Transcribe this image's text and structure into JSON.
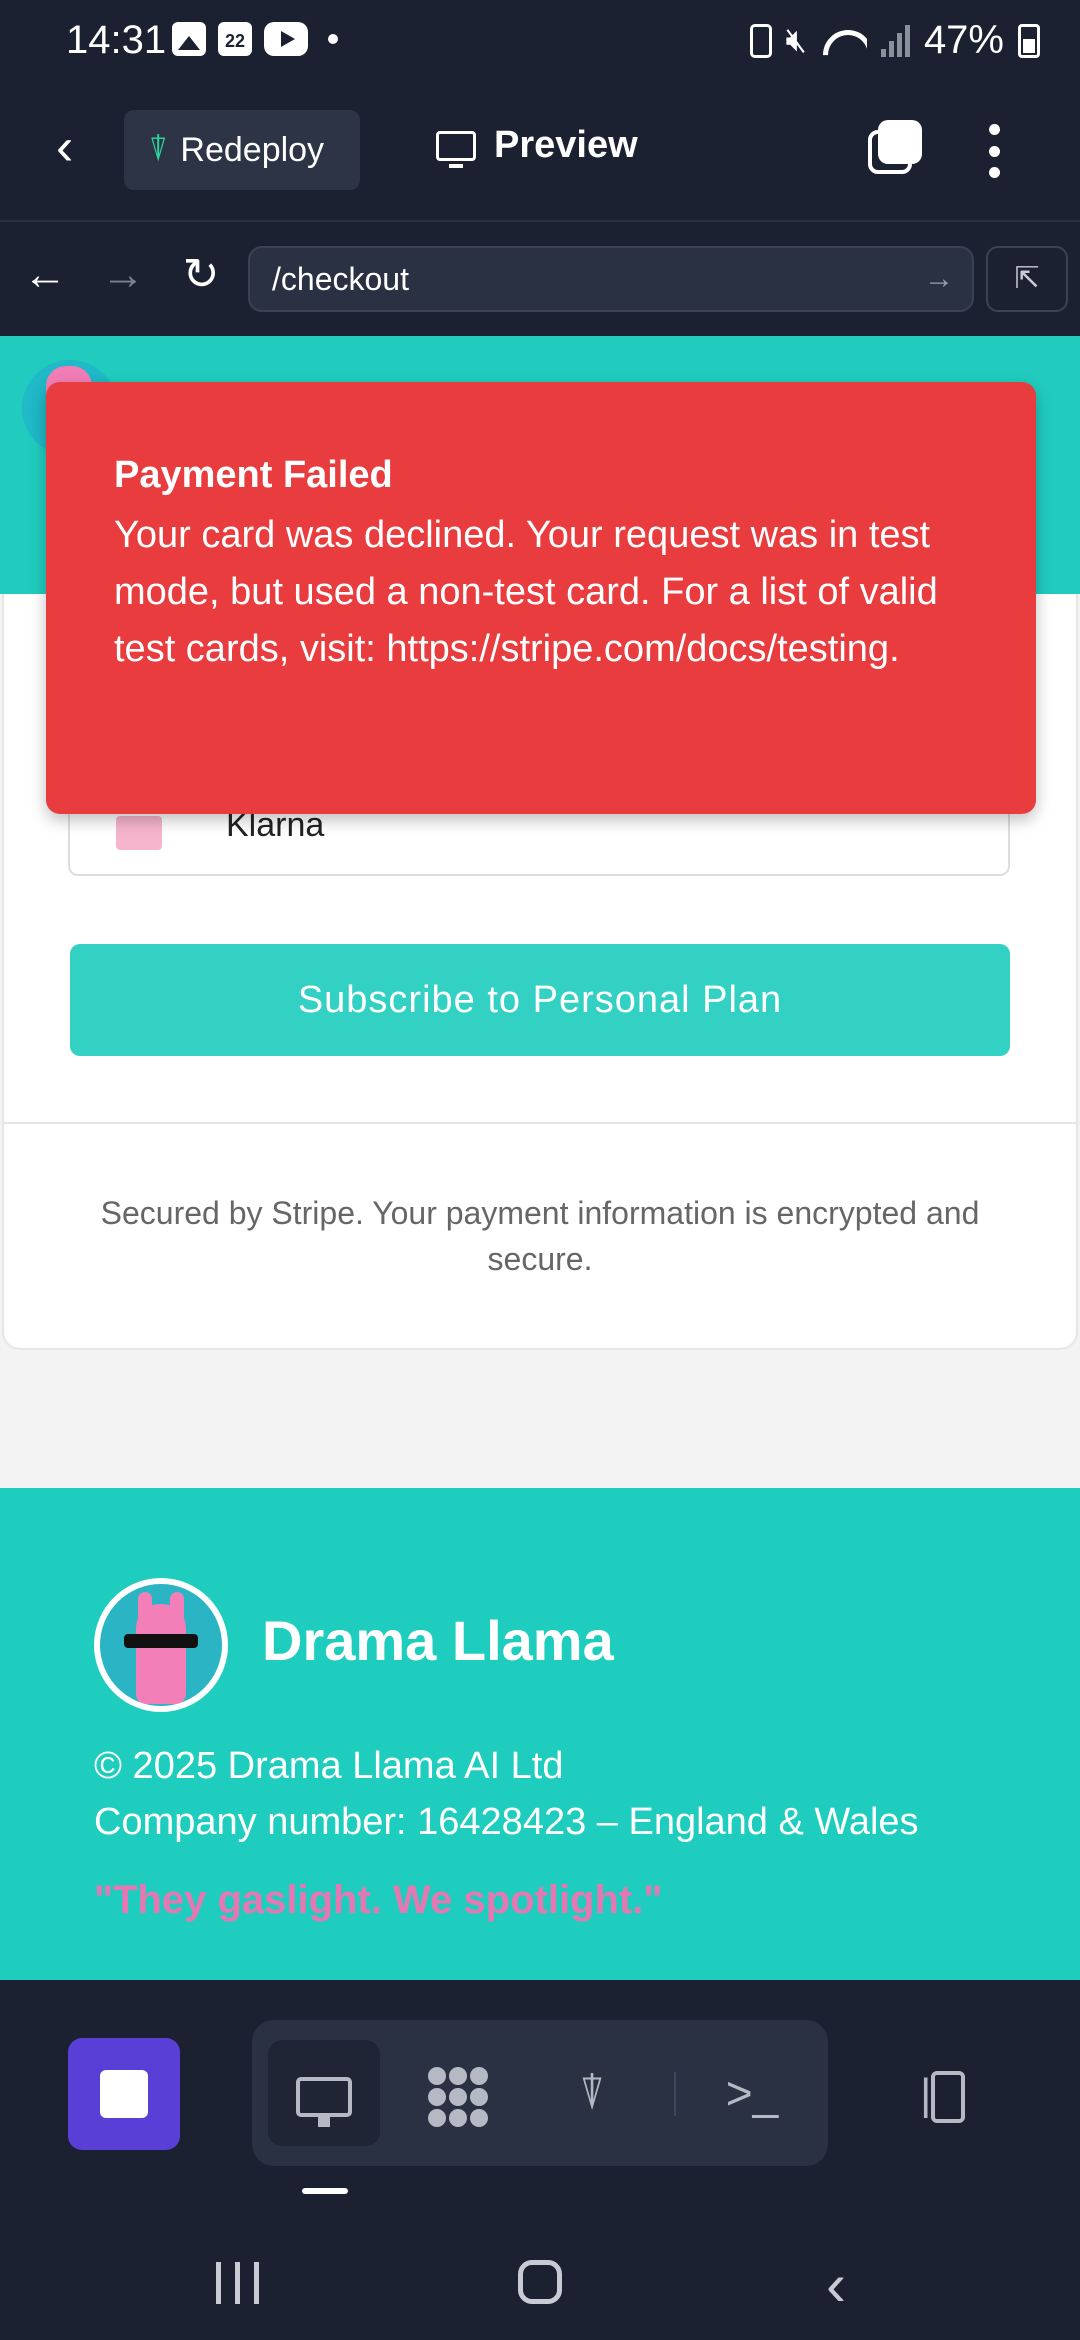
{
  "status_bar": {
    "time": "14:31",
    "calendar_day": "22",
    "battery_percent": "47%",
    "icons": [
      "gallery-icon",
      "calendar-icon",
      "youtube-icon",
      "notification-dot",
      "battery-saver-icon",
      "mute-icon",
      "wifi-icon",
      "signal-icon",
      "battery-icon"
    ]
  },
  "app_header": {
    "redeploy_label": "Redeploy",
    "preview_label": "Preview"
  },
  "url_bar": {
    "url": "/checkout"
  },
  "checkout": {
    "payment_option": "Klarna",
    "subscribe_label": "Subscribe to Personal Plan",
    "secure_note": "Secured by Stripe. Your payment information is encrypted and secure."
  },
  "toast": {
    "title": "Payment Failed",
    "message": "Your card was declined. Your request was in test mode, but used a non-test card. For a list of valid test cards, visit: https://stripe.com/docs/testing."
  },
  "footer": {
    "brand": "Drama Llama",
    "copyright": "© 2025 Drama Llama AI Ltd",
    "company_number": "Company number: 16428423 – England & Wales",
    "tagline": "\"They gaslight. We spotlight.\""
  },
  "toolbar": {
    "tools": [
      "preview-icon",
      "modules-icon",
      "deploy-icon",
      "terminal-icon"
    ],
    "active_tool": "preview-icon",
    "terminal_glyph": ">_"
  },
  "colors": {
    "dark_bg": "#1b2131",
    "teal": "#21ccbf",
    "error_red": "#e83c3e",
    "accent_purple": "#5a3fd6",
    "tagline_pink": "#e478b3"
  }
}
